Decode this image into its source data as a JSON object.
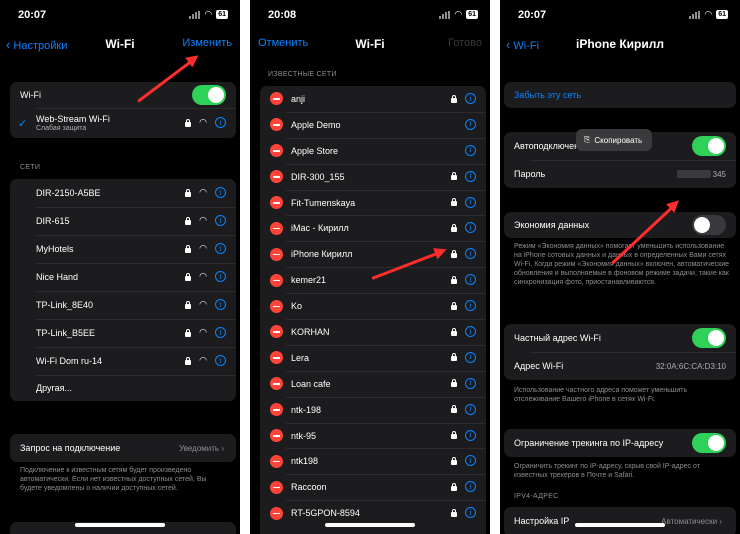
{
  "status": {
    "p1_time": "20:07",
    "p2_time": "20:08",
    "p3_time": "20:07",
    "battery": "61"
  },
  "p1": {
    "nav_back": "Настройки",
    "nav_title": "Wi-Fi",
    "nav_edit": "Изменить",
    "wifi_label": "Wi-Fi",
    "current_network": "Web-Stream Wi-Fi",
    "current_subtitle": "Слабая защита",
    "networks_header": "СЕТИ",
    "networks": [
      "DIR-2150-A5BE",
      "DIR-615",
      "MyHotels",
      "Nice Hand",
      "TP-Link_8E40",
      "TP-Link_B5EE",
      "Wi-Fi Dom ru-14"
    ],
    "other": "Другая...",
    "ask_join_label": "Запрос на подключение",
    "ask_join_value": "Уведомить",
    "ask_join_footer": "Подключение к известным сетям будет произведено автоматически. Если нет известных доступных сетей, Вы будете уведомлены о наличии доступных сетей."
  },
  "p2": {
    "nav_cancel": "Отменить",
    "nav_title": "Wi-Fi",
    "nav_done": "Готово",
    "known_header": "ИЗВЕСТНЫЕ СЕТИ",
    "known": [
      {
        "name": "anji",
        "lock": true
      },
      {
        "name": "Apple Demo",
        "lock": false
      },
      {
        "name": "Apple Store",
        "lock": false
      },
      {
        "name": "DIR-300_155",
        "lock": true
      },
      {
        "name": "Fit-Tumenskaya",
        "lock": true
      },
      {
        "name": "iMac - Кирилл",
        "lock": true
      },
      {
        "name": "iPhone Кирилл",
        "lock": true
      },
      {
        "name": "kemer21",
        "lock": true
      },
      {
        "name": "Ko",
        "lock": true
      },
      {
        "name": "KORHAN",
        "lock": true
      },
      {
        "name": "Lera",
        "lock": true
      },
      {
        "name": "Loan cafe",
        "lock": true
      },
      {
        "name": "ntk-198",
        "lock": true
      },
      {
        "name": "ntk-95",
        "lock": true
      },
      {
        "name": "ntk198",
        "lock": true
      },
      {
        "name": "Raccoon",
        "lock": true
      },
      {
        "name": "RT-5GPON-8594",
        "lock": true
      }
    ]
  },
  "p3": {
    "nav_back": "Wi-Fi",
    "nav_title": "iPhone Кирилл",
    "forget": "Забыть эту сеть",
    "autojoin": "Автоподключение",
    "copied": "Скопировать",
    "password_label": "Пароль",
    "password_tail": "345",
    "low_data": "Экономия данных",
    "low_data_footer": "Режим «Экономия данных» помогает уменьшить использование на iPhone сотовых данных и данных в определенных Вами сетях Wi-Fi. Когда режим «Экономия данных» включен, автоматические обновления и выполняемые в фоновом режиме задачи, такие как синхронизация фото, приостанавливаются.",
    "private_address": "Частный адрес Wi-Fi",
    "wifi_address_label": "Адрес Wi-Fi",
    "wifi_address_value": "32:0A:6C:CA:D3:10",
    "private_footer": "Использование частного адреса поможет уменьшить отслеживание Вашего iPhone в сетях Wi-Fi.",
    "limit_tracking": "Ограничение трекинга по IP-адресу",
    "limit_footer": "Ограничить трекинг по IP-адресу, скрыв свой IP-адрес от известных трекеров в Почте и Safari.",
    "ipv4_header": "IPV4-АДРЕС",
    "configure_ip": "Настройка IP",
    "configure_ip_value": "Автоматически"
  },
  "colors": {
    "accent": "#0a84ff",
    "toggle_on": "#30d158",
    "delete": "#ff453a",
    "annotation_arrow": "#ff2d2d"
  }
}
